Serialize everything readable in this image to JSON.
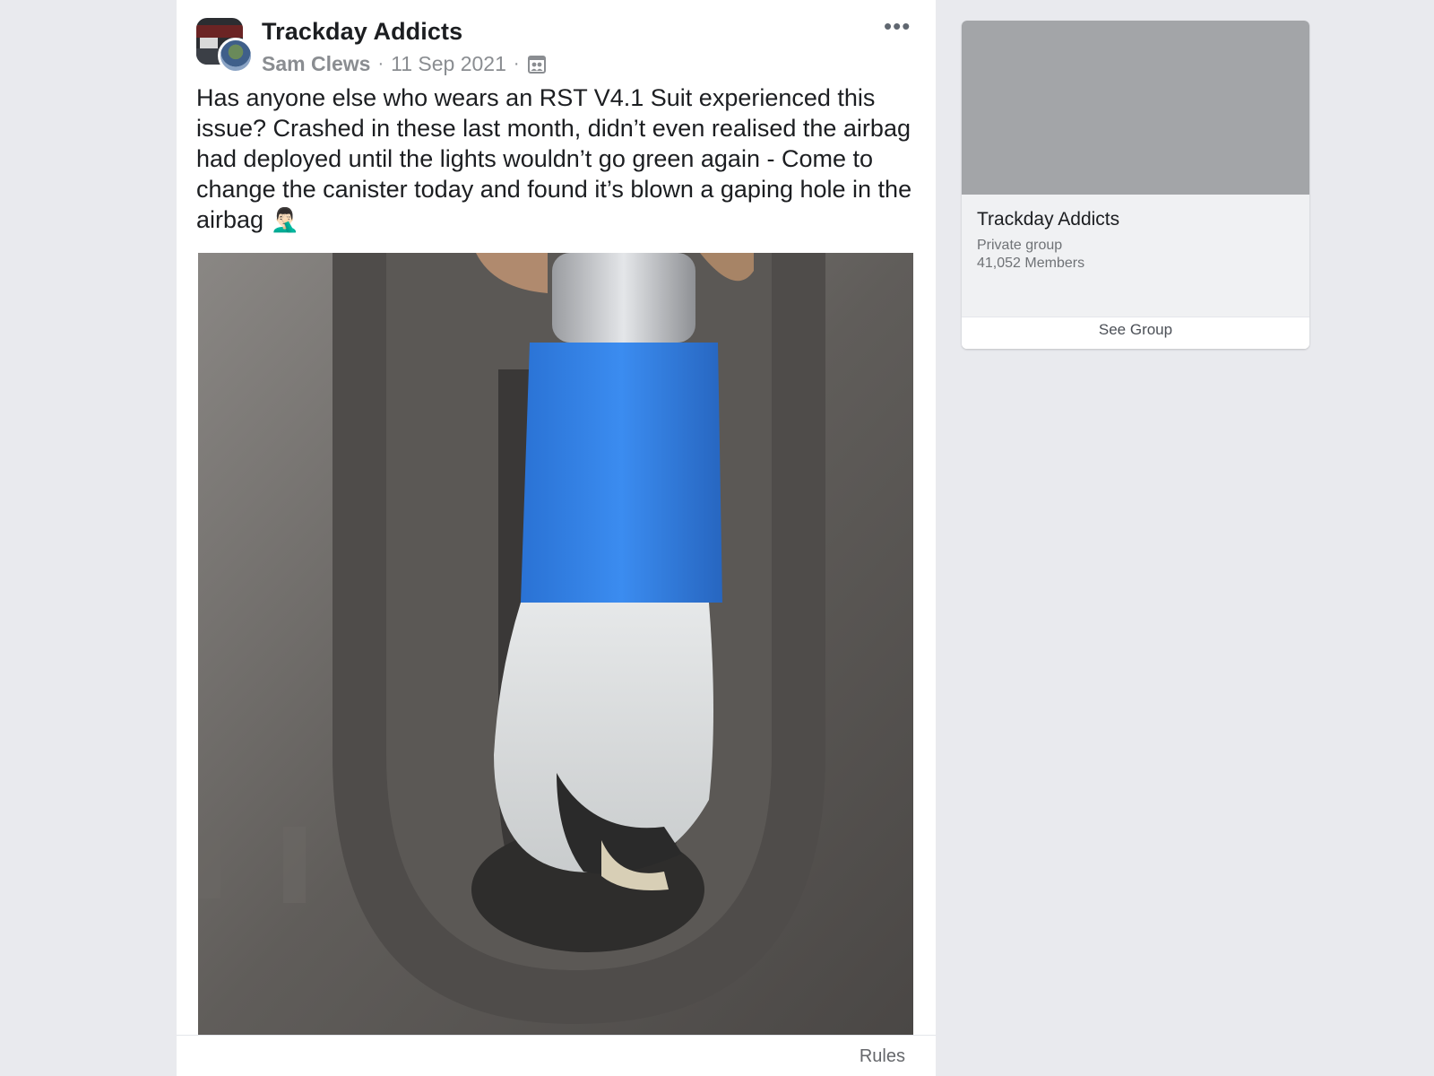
{
  "post": {
    "group_name": "Trackday Addicts",
    "author": "Sam Clews",
    "separator": "·",
    "date": "11 Sep 2021",
    "privacy_icon": "members-icon",
    "more_icon": "more-options-icon",
    "more_glyph": "•••",
    "text": "Has anyone else who wears an RST V4.1 Suit experienced this issue? Crashed in these last month, didn’t even realised the airbag had deployed until the lights wouldn’t go green again - Come to change the canister today and found it’s blown a gaping hole in the airbag",
    "text_emoji": "🤦🏻‍♂️",
    "photo_icon": "post-photo",
    "footer_link": "Rules"
  },
  "sidebar_group": {
    "name": "Trackday Addicts",
    "privacy": "Private group",
    "members": "41,052 Members",
    "button_label": "See Group"
  },
  "colors": {
    "page_background": "#e9eaee",
    "card_background": "#ffffff",
    "primary_text": "#1c1e21",
    "secondary_text": "#8a8d91",
    "cover_gray": "#a3a5a8",
    "tape_blue": "#2f7fe0"
  }
}
